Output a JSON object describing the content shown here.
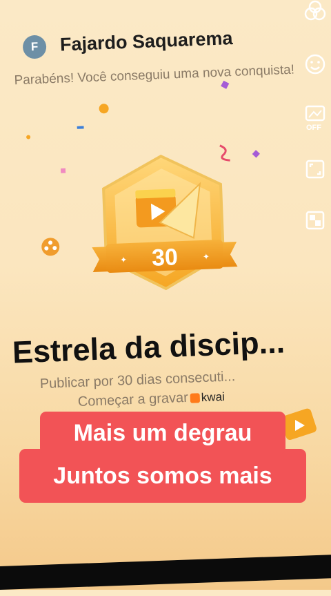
{
  "header": {
    "avatar_letter": "F",
    "username": "Fajardo Saquarema",
    "congrats_text": "Parabéns! Você conseguiu uma nova conquista!"
  },
  "badge": {
    "number": "30"
  },
  "achievement": {
    "title": "Estrela da discip...",
    "description": "Publicar por 30 dias consecuti...",
    "cta": "Começar a gravar",
    "brand": "kwai"
  },
  "captions": {
    "line1": "Mais um degrau",
    "line2": "Juntos somos mais"
  },
  "side_tools": {
    "filter_off_label": "OFF"
  },
  "colors": {
    "caption_bg": "#f25356",
    "badge_gold": "#f6a623",
    "background": "#fbe6bf"
  }
}
